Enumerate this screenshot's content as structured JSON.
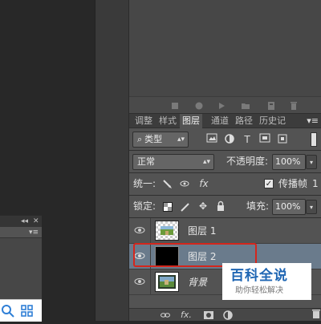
{
  "mini_panel": {
    "collapse_glyph": "◂◂",
    "close_glyph": "✕",
    "menu_glyph": "▾≡"
  },
  "tabs": [
    {
      "label": "调整",
      "active": false
    },
    {
      "label": "样式",
      "active": false
    },
    {
      "label": "图层",
      "active": true
    },
    {
      "label": "通道",
      "active": false
    },
    {
      "label": "路径",
      "active": false
    },
    {
      "label": "历史记",
      "active": false
    }
  ],
  "tab_menu_glyph": "▾≡",
  "filter": {
    "kind_label": "类型",
    "search_glyph": "⌕"
  },
  "blend": {
    "mode": "正常",
    "opacity_label": "不透明度:",
    "opacity_value": "100%"
  },
  "unify": {
    "label": "统一:",
    "propagate_label": "传播帧",
    "propagate_value": "1"
  },
  "lock": {
    "label": "锁定:",
    "fill_label": "填充:",
    "fill_value": "100%"
  },
  "layers": [
    {
      "name": "图层 1",
      "selected": false,
      "italic": false
    },
    {
      "name": "图层 2",
      "selected": true,
      "italic": false
    },
    {
      "name": "背景",
      "selected": false,
      "italic": true
    }
  ],
  "bottom_bar": {
    "fx_label": "fx."
  },
  "watermark": {
    "title": "百科全说",
    "subtitle": "助你轻松解决"
  },
  "colors": {
    "panel_bg": "#535353",
    "selected_row": "#6a7b8c",
    "highlight_box": "#d4261c",
    "watermark_blue": "#1f66b3"
  }
}
